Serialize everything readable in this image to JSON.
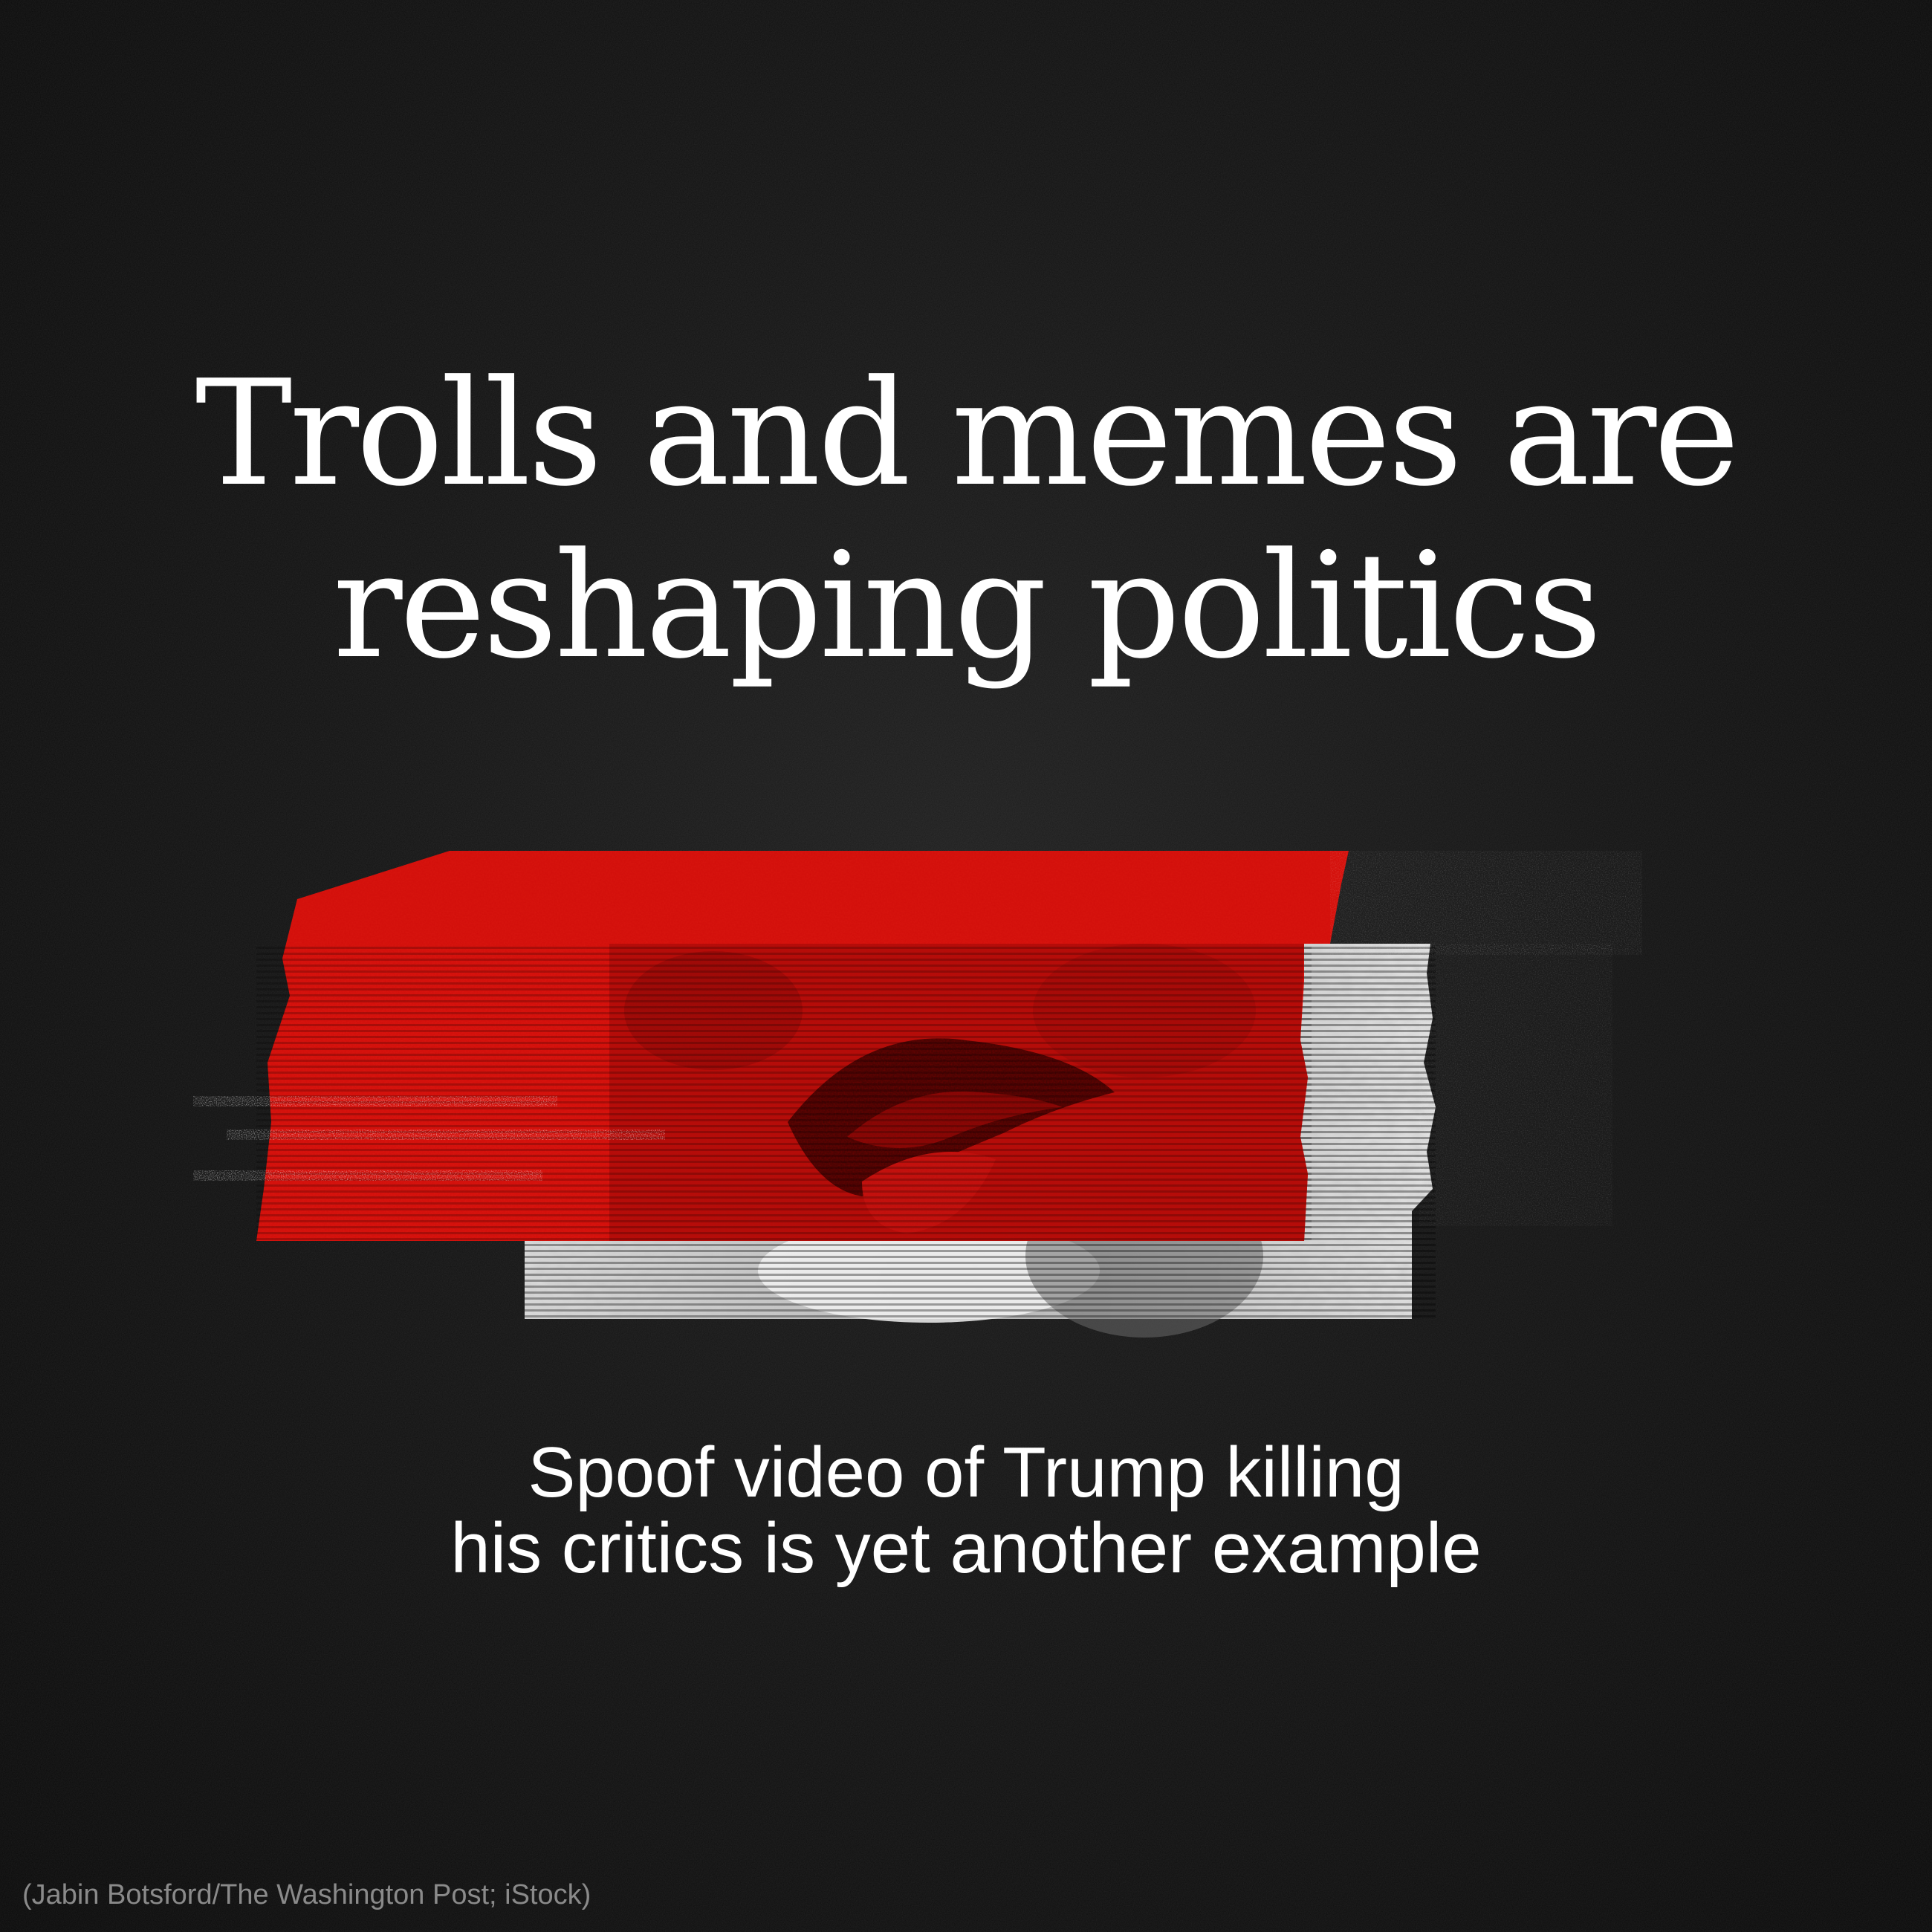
{
  "headline": {
    "line_1": "Trolls and memes are",
    "line_2": "reshaping politics"
  },
  "subhead": {
    "line_1": "Spoof video of Trump killing",
    "line_2": "his critics is yet another example"
  },
  "credit": "(Jabin Botsford/The Washington Post; iStock)",
  "illustration": {
    "description_icon": "glitched-face-mouth-image"
  },
  "colors": {
    "background": "#0b0b0b",
    "accent_red": "#d8150f",
    "text": "#ffffff",
    "credit_text": "#8a8a8a"
  }
}
